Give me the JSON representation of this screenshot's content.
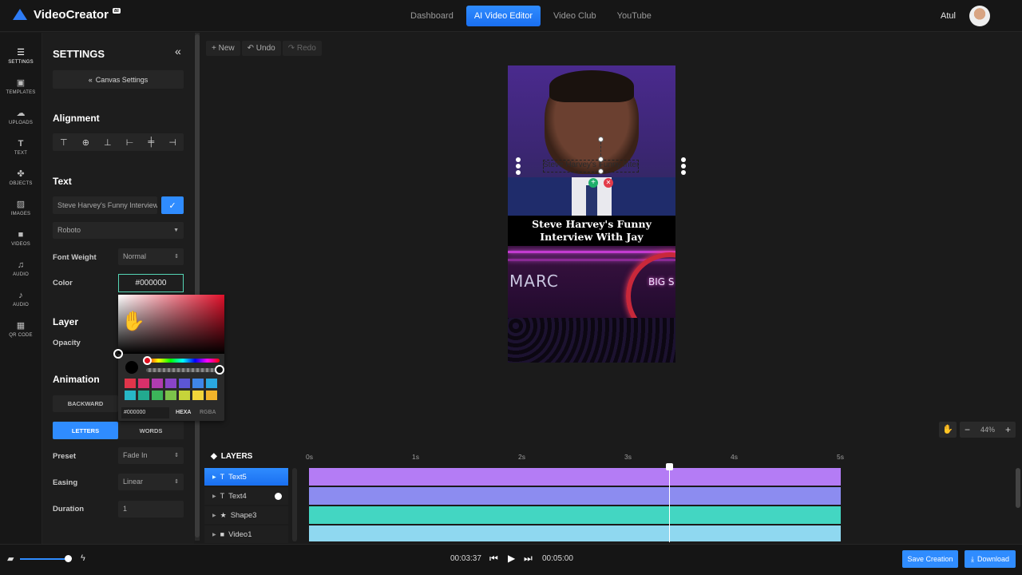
{
  "app": {
    "name": "VideoCreator",
    "badge": "ai"
  },
  "nav": {
    "items": [
      "Dashboard",
      "AI Video Editor",
      "Video Club",
      "YouTube"
    ],
    "active": "AI Video Editor"
  },
  "user": {
    "name": "Atul"
  },
  "rail": [
    {
      "label": "SETTINGS",
      "icon": "sliders-icon"
    },
    {
      "label": "TEMPLATES",
      "icon": "templates-icon"
    },
    {
      "label": "UPLOADS",
      "icon": "cloud-upload-icon"
    },
    {
      "label": "TEXT",
      "icon": "text-icon"
    },
    {
      "label": "OBJECTS",
      "icon": "objects-icon"
    },
    {
      "label": "IMAGES",
      "icon": "image-icon"
    },
    {
      "label": "VIDEOS",
      "icon": "video-camera-icon"
    },
    {
      "label": "AUDIO",
      "icon": "music-list-icon"
    },
    {
      "label": "AUDIO",
      "icon": "microphone-icon"
    },
    {
      "label": "QR CODE",
      "icon": "qr-code-icon"
    }
  ],
  "settings": {
    "title": "SETTINGS",
    "canvas_button": "Canvas Settings",
    "alignment_title": "Alignment",
    "text_title": "Text",
    "text_value": "Steve Harvey's Funny Interview With Jay",
    "font": "Roboto",
    "font_weight_label": "Font Weight",
    "font_weight": "Normal",
    "color_label": "Color",
    "color_value": "#000000",
    "layer_title": "Layer",
    "opacity_label": "Opacity",
    "animation_title": "Animation",
    "direction": "BACKWARD",
    "anim_tabs": [
      "LETTERS",
      "WORDS"
    ],
    "preset_label": "Preset",
    "preset": "Fade In",
    "easing_label": "Easing",
    "easing": "Linear",
    "duration_label": "Duration",
    "duration": "1"
  },
  "picker": {
    "hex": "#000000",
    "modes": [
      "HEXA",
      "RGBA"
    ],
    "swatches": [
      "#e0354a",
      "#d8306a",
      "#b03cb0",
      "#8a44c8",
      "#5c56d4",
      "#3f86e8",
      "#2aa8e0",
      "#27b7c6",
      "#22a98f",
      "#3cb55a",
      "#7cc24a",
      "#c6d43a",
      "#f2d43a",
      "#f2b42a"
    ]
  },
  "toolbar": {
    "new": "+ New",
    "undo": "↶ Undo",
    "redo": "↷ Redo"
  },
  "canvas": {
    "caption_line1": "Steve Harvey's Funny",
    "caption_line2": "Interview With Jay",
    "selected_text": "Steve Harvey's Funny Interview",
    "sign_left": "MARC",
    "sign_right": "BIG S"
  },
  "zoom": {
    "value": "44%"
  },
  "layers": {
    "title": "LAYERS",
    "items": [
      {
        "name": "Text5",
        "icon": "T",
        "color": "#b47cf5"
      },
      {
        "name": "Text4",
        "icon": "T",
        "color": "#8c8cf0"
      },
      {
        "name": "Shape3",
        "icon": "★",
        "color": "#43d6c2"
      },
      {
        "name": "Video1",
        "icon": "■",
        "color": "#8fd8f0"
      }
    ]
  },
  "timeline": {
    "ticks": [
      "0s",
      "1s",
      "2s",
      "3s",
      "4s",
      "5s"
    ]
  },
  "playback": {
    "current": "00:03:37",
    "total": "00:05:00"
  },
  "actions": {
    "save": "Save Creation",
    "download": "Download"
  }
}
